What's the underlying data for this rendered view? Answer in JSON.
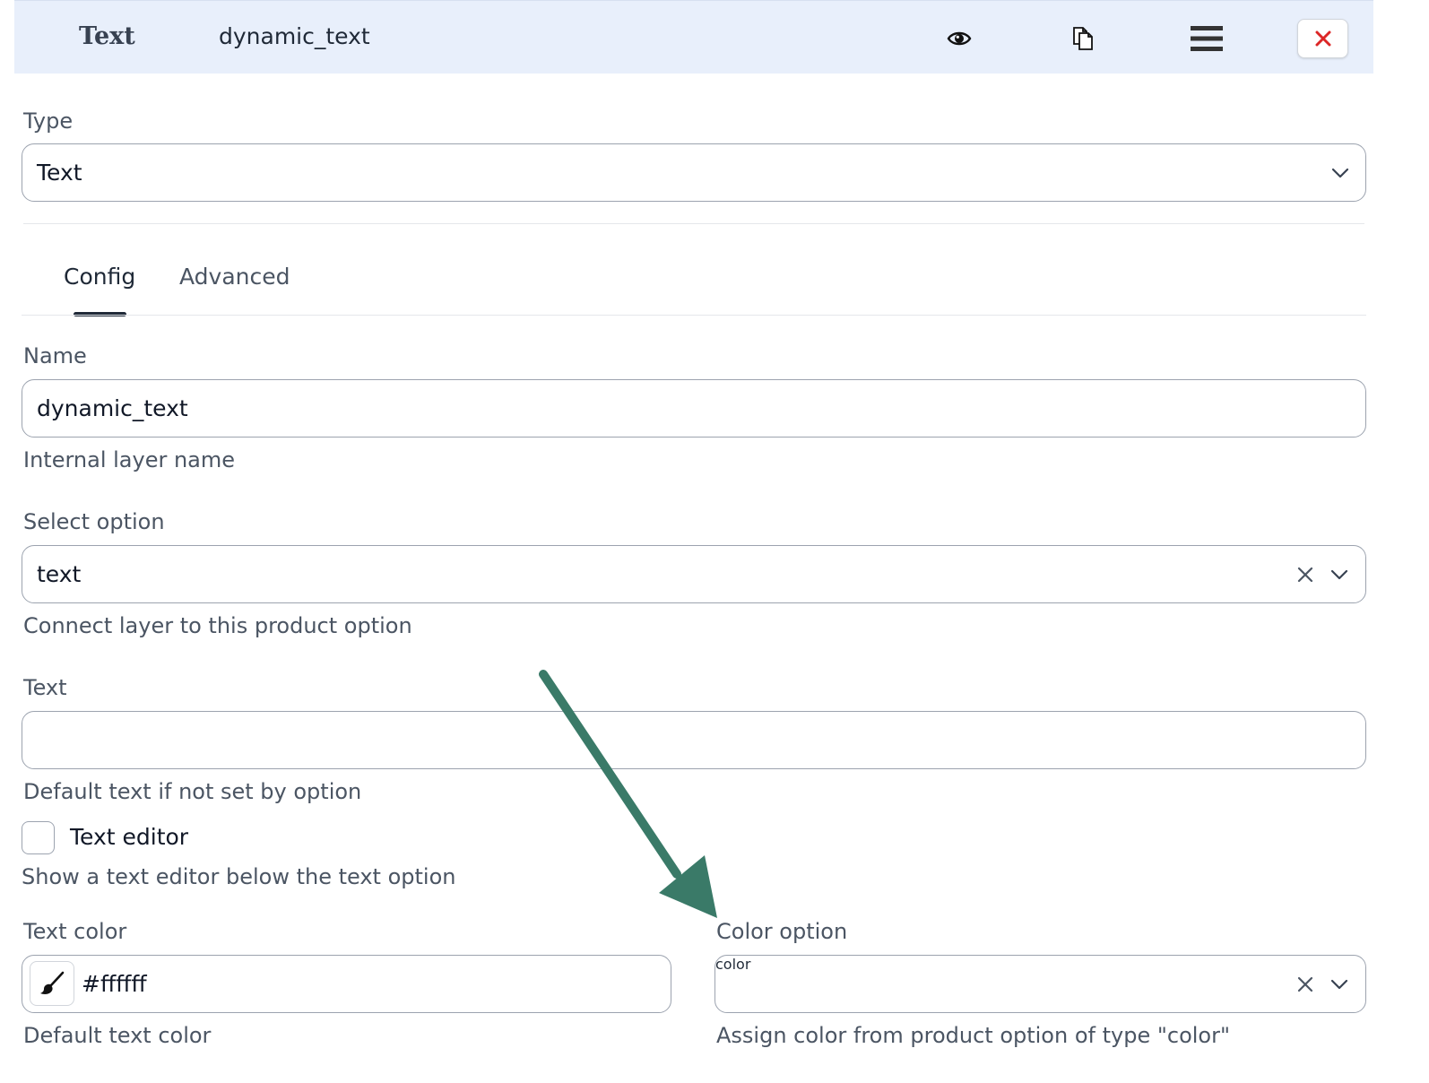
{
  "header": {
    "type_label": "Text",
    "layer_name": "dynamic_text",
    "icons": [
      "eye-icon",
      "copy-icon",
      "menu-icon",
      "close-icon"
    ],
    "close_color": "#dc2626"
  },
  "type_section": {
    "label": "Type",
    "selected": "Text"
  },
  "tabs": [
    {
      "label": "Config",
      "active": true
    },
    {
      "label": "Advanced",
      "active": false
    }
  ],
  "name_field": {
    "label": "Name",
    "value": "dynamic_text",
    "hint": "Internal layer name"
  },
  "select_option": {
    "label": "Select option",
    "value": "text",
    "hint": "Connect layer to this product option"
  },
  "text_field": {
    "label": "Text",
    "value": "",
    "hint": "Default text if not set by option"
  },
  "text_editor": {
    "label": "Text editor",
    "checked": false,
    "hint": "Show a text editor below the text option"
  },
  "text_color": {
    "label": "Text color",
    "value": "#ffffff",
    "hint": "Default text color"
  },
  "color_option": {
    "label": "Color option",
    "value": "color",
    "hint": "Assign color from product option of type \"color\""
  },
  "annotation_arrow_color": "#3a7a68"
}
